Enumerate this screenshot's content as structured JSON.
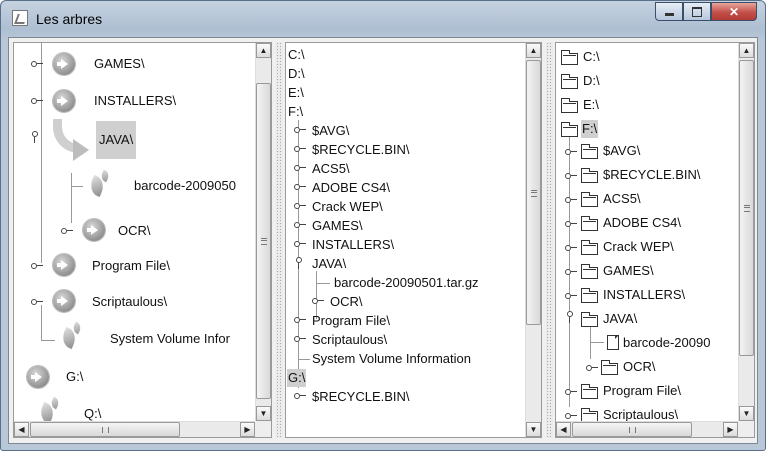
{
  "window": {
    "title": "Les arbres"
  },
  "left_tree": {
    "items": [
      "GAMES\\",
      "INSTALLERS\\",
      "JAVA\\",
      "barcode-2009050",
      "OCR\\",
      "Program File\\",
      "Scriptaulous\\",
      "System Volume Infor",
      "G:\\",
      "Q:\\"
    ]
  },
  "middle_tree": {
    "items": [
      "C:\\",
      "D:\\",
      "E:\\",
      "F:\\",
      "$AVG\\",
      "$RECYCLE.BIN\\",
      "ACS5\\",
      "ADOBE CS4\\",
      "Crack WEP\\",
      "GAMES\\",
      "INSTALLERS\\",
      "JAVA\\",
      "barcode-20090501.tar.gz",
      "OCR\\",
      "Program File\\",
      "Scriptaulous\\",
      "System Volume Information",
      "G:\\",
      "$RECYCLE.BIN\\"
    ]
  },
  "right_tree": {
    "items": [
      "C:\\",
      "D:\\",
      "E:\\",
      "F:\\",
      "$AVG\\",
      "$RECYCLE.BIN\\",
      "ACS5\\",
      "ADOBE CS4\\",
      "Crack WEP\\",
      "GAMES\\",
      "INSTALLERS\\",
      "JAVA\\",
      "barcode-20090",
      "OCR\\",
      "Program File\\",
      "Scriptaulous\\"
    ]
  },
  "scrollbar": {
    "h_thumb_label": "|||"
  }
}
